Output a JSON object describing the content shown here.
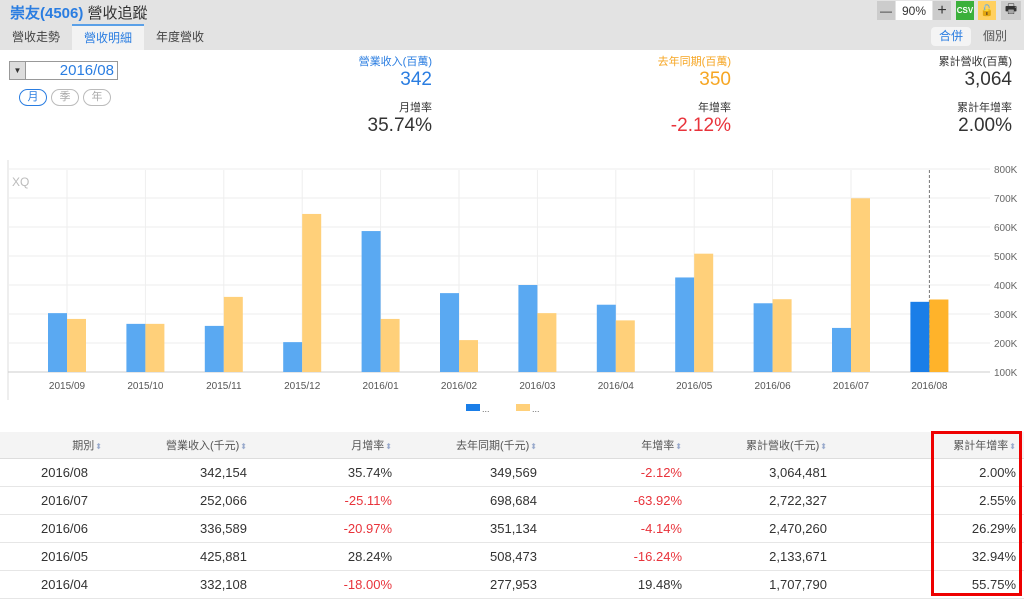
{
  "header": {
    "stock": "崇友(4506)",
    "title": "營收追蹤",
    "zoom": "90%",
    "minus": "—",
    "plus": "+",
    "csv": "CSV",
    "lock": "🔓",
    "print": "🖶"
  },
  "tabs": [
    "營收走勢",
    "營收明細",
    "年度營收"
  ],
  "view_toggle": {
    "merged": "合併",
    "individual": "個別"
  },
  "date_select": {
    "value": "2016/08"
  },
  "period_pills": [
    "月",
    "季",
    "年"
  ],
  "summary": {
    "revenue_label": "營業收入(百萬)",
    "revenue": "342",
    "mom_label": "月增率",
    "mom": "35.74%",
    "ly_label": "去年同期(百萬)",
    "ly": "350",
    "yoy_label": "年增率",
    "yoy": "-2.12%",
    "cum_label": "累計營收(百萬)",
    "cum": "3,064",
    "cum_yoy_label": "累計年增率",
    "cum_yoy": "2.00%"
  },
  "colors": {
    "blue": "#5aa9f2",
    "orange": "#ffd07a",
    "blue_sel": "#1a7ee8",
    "orange_sel": "#ffb32a",
    "neg": "#e8333b",
    "accent": "#2a7de1"
  },
  "chart_data": {
    "type": "bar",
    "watermark": "XQ",
    "categories": [
      "2015/09",
      "2015/10",
      "2015/11",
      "2015/12",
      "2016/01",
      "2016/02",
      "2016/03",
      "2016/04",
      "2016/05",
      "2016/06",
      "2016/07",
      "2016/08"
    ],
    "series": [
      {
        "name": "...",
        "values": [
          303,
          266,
          259,
          203,
          586,
          372,
          400,
          332,
          426,
          337,
          252,
          342
        ]
      },
      {
        "name": "...",
        "values": [
          283,
          266,
          359,
          645,
          283,
          210,
          303,
          278,
          508,
          351,
          699,
          350
        ]
      }
    ],
    "yticks": [
      "100K",
      "200K",
      "300K",
      "400K",
      "500K",
      "600K",
      "700K",
      "800K"
    ],
    "ylim": [
      100,
      800
    ],
    "unit": "K"
  },
  "table": {
    "headers": [
      "期別",
      "營業收入(千元)",
      "月增率",
      "去年同期(千元)",
      "年增率",
      "累計營收(千元)",
      "累計年增率"
    ],
    "rows": [
      [
        "2016/08",
        "342,154",
        "35.74%",
        "349,569",
        "-2.12%",
        "3,064,481",
        "2.00%"
      ],
      [
        "2016/07",
        "252,066",
        "-25.11%",
        "698,684",
        "-63.92%",
        "2,722,327",
        "2.55%"
      ],
      [
        "2016/06",
        "336,589",
        "-20.97%",
        "351,134",
        "-4.14%",
        "2,470,260",
        "26.29%"
      ],
      [
        "2016/05",
        "425,881",
        "28.24%",
        "508,473",
        "-16.24%",
        "2,133,671",
        "32.94%"
      ],
      [
        "2016/04",
        "332,108",
        "-18.00%",
        "277,953",
        "19.48%",
        "1,707,790",
        "55.75%"
      ]
    ]
  }
}
